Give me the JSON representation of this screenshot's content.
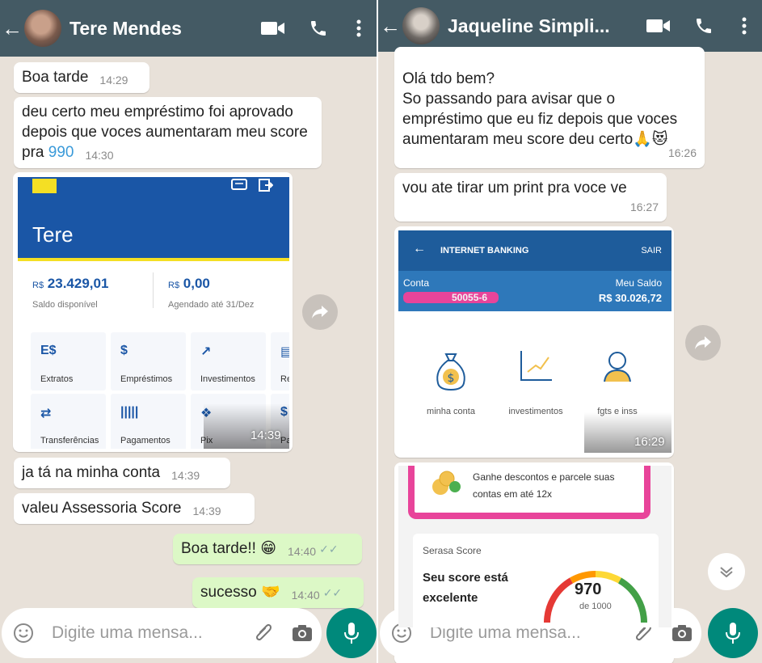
{
  "left_chat": {
    "contact_name": "Tere Mendes",
    "messages": [
      {
        "text": "Boa tarde",
        "time": "14:29"
      },
      {
        "text_before": "deu certo meu empréstimo foi aprovado depois que voces aumentaram meu score pra ",
        "highlight": "990",
        "time": "14:30"
      },
      {
        "text": "ja tá na minha conta",
        "time": "14:39"
      },
      {
        "text": "valeu Assessoria Score",
        "time": "14:39"
      },
      {
        "text": "Boa tarde!! 😁",
        "time": "14:40"
      },
      {
        "text": "sucesso 🤝",
        "time": "14:40"
      }
    ],
    "image_time": "14:39",
    "bank": {
      "name": "Tere",
      "balance": "23.429,01",
      "balance_currency": "R$",
      "balance_label": "Saldo disponível",
      "scheduled": "0,00",
      "scheduled_currency": "R$",
      "scheduled_label": "Agendado até 31/Dez",
      "tiles": [
        {
          "label": "Extratos",
          "icon": "statement-icon"
        },
        {
          "label": "Empréstimos",
          "icon": "loan-icon"
        },
        {
          "label": "Investimentos",
          "icon": "chart-icon"
        },
        {
          "label": "Re",
          "icon": "doc-icon"
        },
        {
          "label": "Transferências",
          "icon": "transfer-icon"
        },
        {
          "label": "Pagamentos",
          "icon": "barcode-icon"
        },
        {
          "label": "Pix",
          "icon": "pix-icon"
        },
        {
          "label": "Pa",
          "icon": "pay-icon"
        }
      ]
    },
    "input_placeholder": "Digite uma mensa..."
  },
  "right_chat": {
    "contact_name": "Jaqueline Simpli...",
    "messages": [
      {
        "text": "Olá tdo bem?\nSo passando para avisar que o empréstimo que eu  fiz depois que voces aumentaram meu score deu certo🙏😻",
        "time": "16:26"
      },
      {
        "text": "vou ate tirar um print pra voce ve",
        "time": "16:27"
      }
    ],
    "image_time": "16:29",
    "bank": {
      "header": "INTERNET BANKING",
      "logout": "SAIR",
      "account_label": "Conta",
      "account_number": "50055-6",
      "balance_label": "Meu Saldo",
      "balance": "R$ 30.026,72",
      "items": [
        "minha conta",
        "investimentos",
        "fgts e inss"
      ]
    },
    "promo": "Ganhe descontos e parcele suas contas em até 12x",
    "serasa": {
      "brand": "Serasa Score",
      "headline": "Seu score está excelente",
      "score": "970",
      "max": "de 1000"
    },
    "input_placeholder": "Digite uma mensa..."
  },
  "colors": {
    "header": "#445a64",
    "chat_bg": "#e8e1d9",
    "outgoing_bubble": "#dcf8c6",
    "accent_green": "#00897b"
  }
}
